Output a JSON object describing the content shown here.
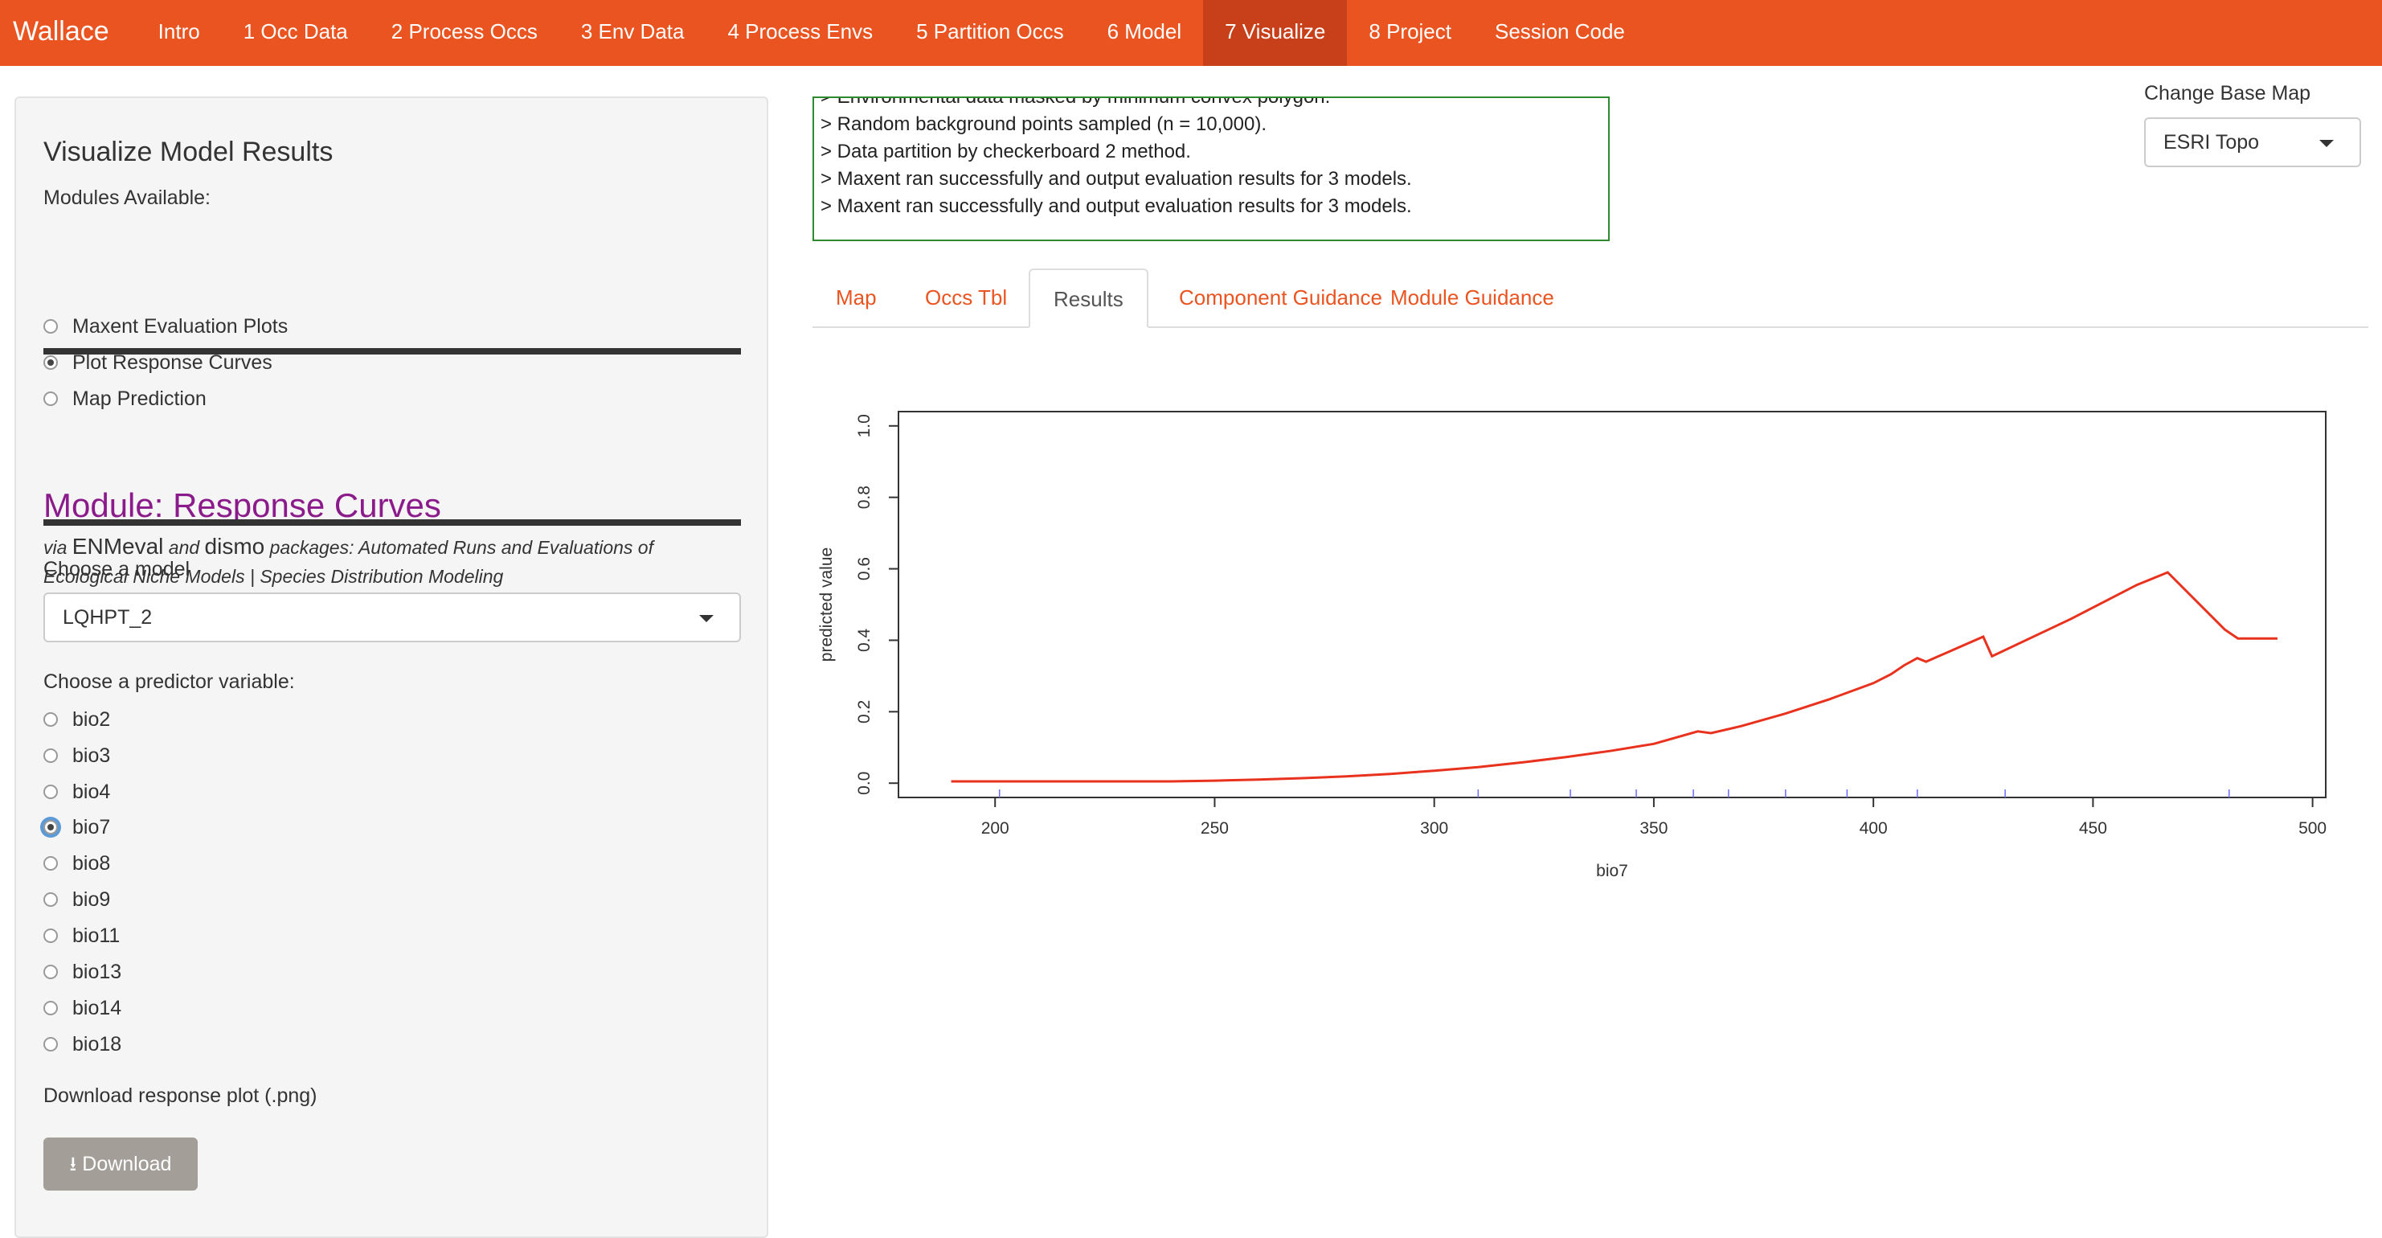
{
  "navbar": {
    "brand": "Wallace",
    "items": [
      {
        "label": "Intro",
        "active": false
      },
      {
        "label": "1 Occ Data",
        "active": false
      },
      {
        "label": "2 Process Occs",
        "active": false
      },
      {
        "label": "3 Env Data",
        "active": false
      },
      {
        "label": "4 Process Envs",
        "active": false
      },
      {
        "label": "5 Partition Occs",
        "active": false
      },
      {
        "label": "6 Model",
        "active": false
      },
      {
        "label": "7 Visualize",
        "active": true
      },
      {
        "label": "8 Project",
        "active": false
      },
      {
        "label": "Session Code",
        "active": false
      }
    ]
  },
  "sidebar": {
    "title": "Visualize Model Results",
    "modules_label": "Modules Available:",
    "modules": [
      {
        "label": "Maxent Evaluation Plots",
        "checked": false
      },
      {
        "label": "Plot Response Curves",
        "checked": true
      },
      {
        "label": "Map Prediction",
        "checked": false
      }
    ],
    "module_title": "Module: Response Curves",
    "module_sub_via": "via",
    "module_sub_pkg1": "ENMeval",
    "module_sub_and": "and",
    "module_sub_pkg2": "dismo",
    "module_sub_rest": "packages: Automated Runs and Evaluations of Ecological Niche Models | Species Distribution Modeling",
    "model_label": "Choose a model",
    "model_value": "LQHPT_2",
    "predictor_label": "Choose a predictor variable:",
    "predictors": [
      {
        "label": "bio2",
        "checked": false
      },
      {
        "label": "bio3",
        "checked": false
      },
      {
        "label": "bio4",
        "checked": false
      },
      {
        "label": "bio7",
        "checked": true
      },
      {
        "label": "bio8",
        "checked": false
      },
      {
        "label": "bio9",
        "checked": false
      },
      {
        "label": "bio11",
        "checked": false
      },
      {
        "label": "bio13",
        "checked": false
      },
      {
        "label": "bio14",
        "checked": false
      },
      {
        "label": "bio18",
        "checked": false
      }
    ],
    "download_label": "Download response plot (.png)",
    "download_button": "Download"
  },
  "log": {
    "lines": [
      "> Environmental data masked by minimum convex polygon.",
      "> Random background points sampled (n = 10,000).",
      "> Data partition by checkerboard 2 method.",
      "> Maxent ran successfully and output evaluation results for 3 models.",
      "> Maxent ran successfully and output evaluation results for 3 models."
    ]
  },
  "basemap": {
    "label": "Change Base Map",
    "value": "ESRI Topo"
  },
  "tabs": [
    {
      "label": "Map",
      "active": false
    },
    {
      "label": "Occs Tbl",
      "active": false
    },
    {
      "label": "Results",
      "active": true
    },
    {
      "label": "Component Guidance",
      "active": false
    },
    {
      "label": "Module Guidance",
      "active": false
    }
  ],
  "colors": {
    "navbar": "#ea5421",
    "navbar_active": "#c7401a",
    "module_title": "#8b1a8a",
    "log_border": "#2f8a2f",
    "curve": "#e8321e",
    "rug": "#6b6bff"
  },
  "chart_data": {
    "type": "line",
    "title": "",
    "xlabel": "bio7",
    "ylabel": "predicted value",
    "xlim": [
      178,
      503
    ],
    "ylim": [
      -0.04,
      1.04
    ],
    "xticks": [
      200,
      250,
      300,
      350,
      400,
      450,
      500
    ],
    "yticks": [
      0.0,
      0.2,
      0.4,
      0.6,
      0.8,
      1.0
    ],
    "series": [
      {
        "x": [
          190,
          200,
          220,
          240,
          250,
          260,
          270,
          280,
          290,
          300,
          310,
          320,
          330,
          340,
          350,
          360,
          363,
          370,
          380,
          390,
          400,
          404,
          407,
          410,
          412,
          425,
          427,
          445,
          460,
          467,
          480,
          483,
          492
        ],
        "y": [
          0.005,
          0.005,
          0.005,
          0.005,
          0.007,
          0.01,
          0.014,
          0.019,
          0.026,
          0.035,
          0.045,
          0.058,
          0.073,
          0.09,
          0.11,
          0.145,
          0.14,
          0.16,
          0.195,
          0.235,
          0.28,
          0.305,
          0.33,
          0.35,
          0.34,
          0.41,
          0.355,
          0.46,
          0.555,
          0.59,
          0.43,
          0.405,
          0.405
        ]
      }
    ],
    "rug_x": [
      201,
      310,
      331,
      346,
      359,
      367,
      380,
      394,
      410,
      430,
      481
    ]
  }
}
